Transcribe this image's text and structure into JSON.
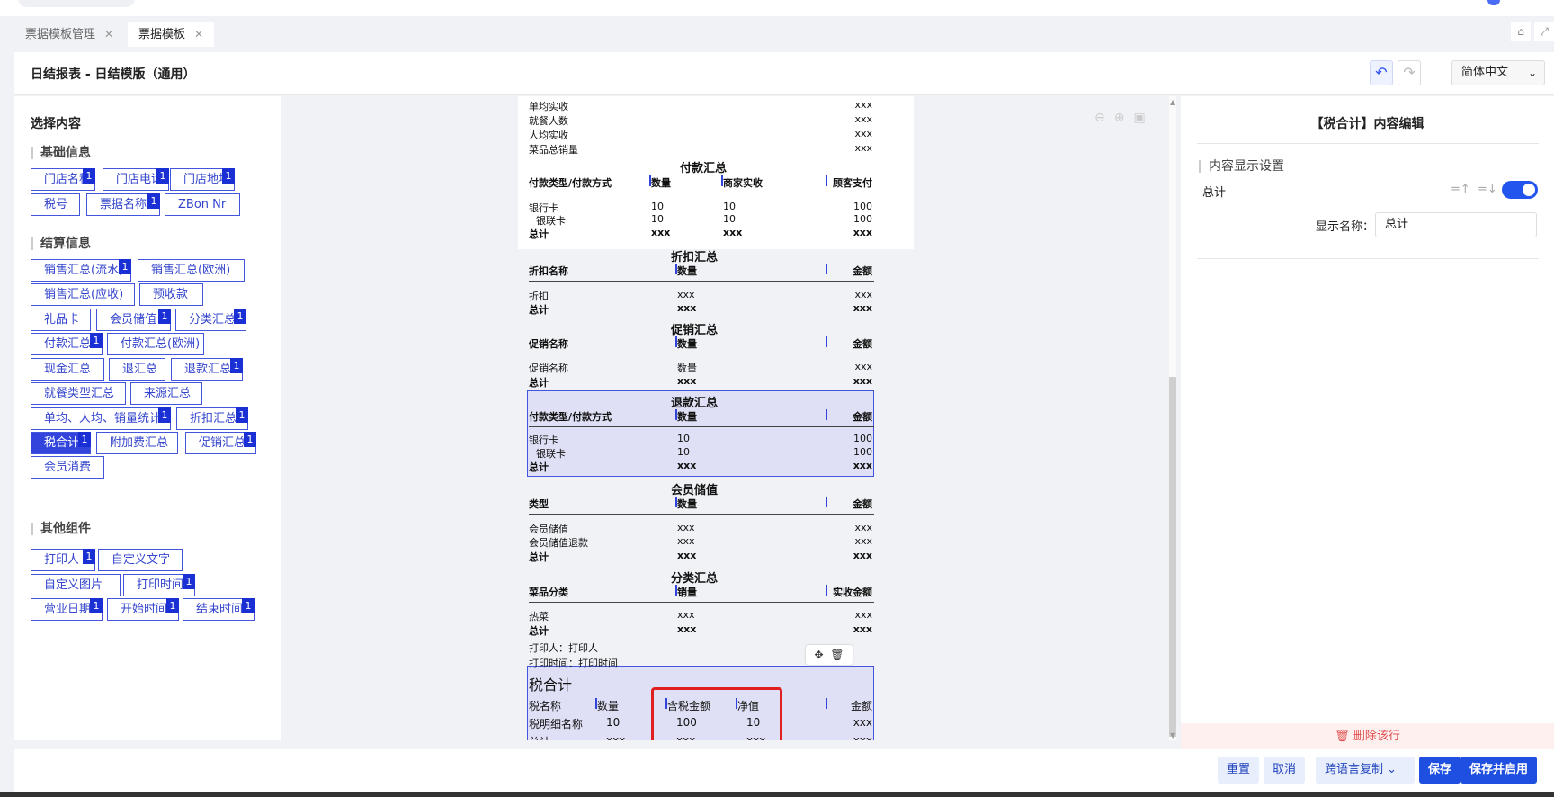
{
  "tabs": [
    {
      "label": "票据模板管理",
      "close": "✕"
    },
    {
      "label": "票据模板",
      "close": "✕"
    }
  ],
  "header": {
    "title": "日结报表 - 日结模版（通用）",
    "language": "简体中文"
  },
  "left": {
    "title": "选择内容",
    "sections": [
      {
        "title": "基础信息"
      },
      {
        "title": "结算信息"
      },
      {
        "title": "其他组件"
      }
    ],
    "chips": [
      {
        "label": "门店名称",
        "badge": "1"
      },
      {
        "label": "门店电话",
        "badge": "1"
      },
      {
        "label": "门店地址",
        "badge": "1"
      },
      {
        "label": "税号",
        "badge": ""
      },
      {
        "label": "票据名称",
        "badge": "1"
      },
      {
        "label": "ZBon Nr",
        "badge": ""
      },
      {
        "label": "销售汇总(流水)",
        "badge": "1"
      },
      {
        "label": "销售汇总(欧洲)",
        "badge": ""
      },
      {
        "label": "销售汇总(应收)",
        "badge": ""
      },
      {
        "label": "预收款",
        "badge": ""
      },
      {
        "label": "礼品卡",
        "badge": ""
      },
      {
        "label": "会员储值",
        "badge": "1"
      },
      {
        "label": "分类汇总",
        "badge": "1"
      },
      {
        "label": "付款汇总",
        "badge": "1"
      },
      {
        "label": "付款汇总(欧洲)",
        "badge": ""
      },
      {
        "label": "现金汇总",
        "badge": ""
      },
      {
        "label": "退汇总",
        "badge": ""
      },
      {
        "label": "退款汇总",
        "badge": "1"
      },
      {
        "label": "就餐类型汇总",
        "badge": ""
      },
      {
        "label": "来源汇总",
        "badge": ""
      },
      {
        "label": "单均、人均、销量统计",
        "badge": "1"
      },
      {
        "label": "折扣汇总",
        "badge": "1"
      },
      {
        "label": "税合计",
        "badge": "1"
      },
      {
        "label": "附加费汇总",
        "badge": ""
      },
      {
        "label": "促销汇总",
        "badge": "1"
      },
      {
        "label": "会员消费",
        "badge": ""
      },
      {
        "label": "打印人",
        "badge": "1"
      },
      {
        "label": "自定义文字",
        "badge": ""
      },
      {
        "label": "自定义图片",
        "badge": ""
      },
      {
        "label": "打印时间",
        "badge": "1"
      },
      {
        "label": "营业日期",
        "badge": "1"
      },
      {
        "label": "开始时间",
        "badge": "1"
      },
      {
        "label": "结束时间",
        "badge": "1"
      }
    ]
  },
  "receipt": {
    "top_rows": [
      {
        "label": "单均实收",
        "value": "xxx"
      },
      {
        "label": "就餐人数",
        "value": "xxx"
      },
      {
        "label": "人均实收",
        "value": "xxx"
      },
      {
        "label": "菜品总销量",
        "value": "xxx"
      }
    ],
    "payment": {
      "title": "付款汇总",
      "headers": [
        "付款类型/付款方式",
        "数量",
        "商家实收",
        "顾客支付"
      ],
      "rows": [
        [
          "银行卡",
          "10",
          "10",
          "100"
        ],
        [
          "银联卡",
          "10",
          "10",
          "100"
        ],
        [
          "总计",
          "xxx",
          "xxx",
          "xxx"
        ]
      ]
    },
    "discount": {
      "title": "折扣汇总",
      "headers": [
        "折扣名称",
        "数量",
        "金额"
      ],
      "rows": [
        [
          "折扣",
          "xxx",
          "xxx"
        ],
        [
          "总计",
          "xxx",
          "xxx"
        ]
      ]
    },
    "promo": {
      "title": "促销汇总",
      "headers": [
        "促销名称",
        "数量",
        "金额"
      ],
      "rows": [
        [
          "促销名称",
          "数量",
          "xxx"
        ],
        [
          "总计",
          "xxx",
          "xxx"
        ]
      ]
    },
    "refund": {
      "title": "退款汇总",
      "headers": [
        "付款类型/付款方式",
        "数量",
        "金额"
      ],
      "rows": [
        [
          "银行卡",
          "10",
          "100"
        ],
        [
          "银联卡",
          "10",
          "100"
        ],
        [
          "总计",
          "xxx",
          "xxx"
        ]
      ]
    },
    "member": {
      "title": "会员储值",
      "headers": [
        "类型",
        "数量",
        "金额"
      ],
      "rows": [
        [
          "会员储值",
          "xxx",
          "xxx"
        ],
        [
          "会员储值退款",
          "xxx",
          "xxx"
        ],
        [
          "总计",
          "xxx",
          "xxx"
        ]
      ]
    },
    "category": {
      "title": "分类汇总",
      "headers": [
        "菜品分类",
        "销量",
        "实收金额"
      ],
      "rows": [
        [
          "热菜",
          "xxx",
          "xxx"
        ],
        [
          "总计",
          "xxx",
          "xxx"
        ]
      ]
    },
    "printer": "打印人：打印人",
    "print_time": "打印时间：打印时间",
    "tax": {
      "title": "税合计",
      "headers": [
        "税名称",
        "数量",
        "含税金额",
        "净值",
        "金额"
      ],
      "rows": [
        [
          "税明细名称",
          "10",
          "100",
          "10",
          "xxx"
        ],
        [
          "总计",
          "xxx",
          "xxx",
          "xxx",
          "xxx"
        ]
      ]
    }
  },
  "right": {
    "title": "【税合计】内容编辑",
    "section": "内容显示设置",
    "item": "总计",
    "display_name_label": "显示名称：",
    "display_name_value": "总计",
    "toggle_on": true,
    "delete": "删除该行"
  },
  "footer": {
    "reset": "重置",
    "cancel": "取消",
    "copy": "跨语言复制",
    "save": "保存",
    "save_enable": "保存并启用"
  },
  "colors": {
    "accent": "#1f4fe0",
    "chip": "#3344cc",
    "highlight": "#dfe0f5",
    "annotation": "#e02020"
  }
}
